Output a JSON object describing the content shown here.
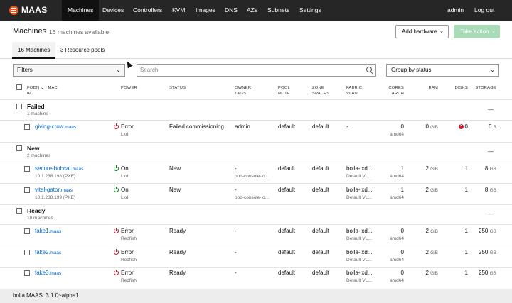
{
  "nav": {
    "brand": "MAAS",
    "items": [
      "Machines",
      "Devices",
      "Controllers",
      "KVM",
      "Images",
      "DNS",
      "AZs",
      "Subnets",
      "Settings"
    ],
    "user": "admin",
    "logout": "Log out"
  },
  "header": {
    "title": "Machines",
    "subtitle": "16 machines available",
    "add_hardware": "Add hardware",
    "take_action": "Take action"
  },
  "tabs": [
    "16 Machines",
    "3 Resource pools"
  ],
  "filters": {
    "filter_label": "Filters",
    "search_placeholder": "Search",
    "group_by": "Group by status"
  },
  "columns": {
    "fqdn": "FQDN",
    "mac": "| MAC",
    "ip": "IP",
    "power": "POWER",
    "status": "STATUS",
    "owner": "OWNER",
    "tags": "TAGS",
    "pool": "POOL",
    "note": "NOTE",
    "zone": "ZONE",
    "spaces": "SPACES",
    "fabric": "FABRIC",
    "vlan": "VLAN",
    "cores": "CORES",
    "arch": "ARCH",
    "ram": "RAM",
    "disks": "DISKS",
    "storage": "STORAGE"
  },
  "groups": [
    {
      "name": "Failed",
      "count": "1 machine",
      "collapse": "—",
      "machines": [
        {
          "host": "giving-crow",
          "domain": ".maas",
          "ip": "",
          "power": "Error",
          "power_type": "Lxd",
          "power_state": "off",
          "status": "Failed commissioning",
          "owner": "admin",
          "tags": "",
          "pool": "default",
          "zone": "default",
          "fabric": "-",
          "vlan": "",
          "cores": "0",
          "arch": "amd64",
          "ram": "0",
          "ram_unit": "GiB",
          "disks": "0",
          "disk_error": true,
          "storage": "0",
          "storage_unit": "B"
        }
      ]
    },
    {
      "name": "New",
      "count": "2 machines",
      "collapse": "—",
      "machines": [
        {
          "host": "secure-bobcat",
          "domain": ".maas",
          "ip": "10.1.238.198 (PXE)",
          "power": "On",
          "power_type": "Lxd",
          "power_state": "on",
          "status": "New",
          "owner": "-",
          "tags": "pod-console-lo...",
          "pool": "default",
          "zone": "default",
          "fabric": "bolla-lxd...",
          "vlan": "Default VL...",
          "cores": "1",
          "arch": "amd64",
          "ram": "2",
          "ram_unit": "GiB",
          "disks": "1",
          "disk_error": false,
          "storage": "8",
          "storage_unit": "GB"
        },
        {
          "host": "vital-gator",
          "domain": ".maas",
          "ip": "10.1.238.199 (PXE)",
          "power": "On",
          "power_type": "Lxd",
          "power_state": "on",
          "status": "New",
          "owner": "-",
          "tags": "pod-console-lo...",
          "pool": "default",
          "zone": "default",
          "fabric": "bolla-lxd...",
          "vlan": "Default VL...",
          "cores": "1",
          "arch": "amd64",
          "ram": "2",
          "ram_unit": "GiB",
          "disks": "1",
          "disk_error": false,
          "storage": "8",
          "storage_unit": "GB"
        }
      ]
    },
    {
      "name": "Ready",
      "count": "10 machines",
      "collapse": "—",
      "machines": [
        {
          "host": "fake1",
          "domain": ".maas",
          "ip": "",
          "power": "Error",
          "power_type": "Redfish",
          "power_state": "off",
          "status": "Ready",
          "owner": "-",
          "tags": "",
          "pool": "default",
          "zone": "default",
          "fabric": "bolla-lxd...",
          "vlan": "Default VL...",
          "cores": "0",
          "arch": "amd64",
          "ram": "2",
          "ram_unit": "GiB",
          "disks": "1",
          "disk_error": false,
          "storage": "250",
          "storage_unit": "GB"
        },
        {
          "host": "fake2",
          "domain": ".maas",
          "ip": "",
          "power": "Error",
          "power_type": "Redfish",
          "power_state": "off",
          "status": "Ready",
          "owner": "-",
          "tags": "",
          "pool": "default",
          "zone": "default",
          "fabric": "bolla-lxd...",
          "vlan": "Default VL...",
          "cores": "0",
          "arch": "amd64",
          "ram": "2",
          "ram_unit": "GiB",
          "disks": "1",
          "disk_error": false,
          "storage": "250",
          "storage_unit": "GB"
        },
        {
          "host": "fake3",
          "domain": ".maas",
          "ip": "",
          "power": "Error",
          "power_type": "Redfish",
          "power_state": "off",
          "status": "Ready",
          "owner": "-",
          "tags": "",
          "pool": "default",
          "zone": "default",
          "fabric": "bolla-lxd...",
          "vlan": "Default VL...",
          "cores": "0",
          "arch": "amd64",
          "ram": "2",
          "ram_unit": "GiB",
          "disks": "1",
          "disk_error": false,
          "storage": "250",
          "storage_unit": "GB"
        }
      ]
    }
  ],
  "footer": {
    "host": "bolla MAAS:",
    "version": "3.1.0~alpha1"
  },
  "colors": {
    "nav_bg": "#262626",
    "logo": "#e95420",
    "link": "#0066cc",
    "power_on": "#0e8420",
    "power_error": "#c7162b",
    "take_action_disabled": "#a9dbb7"
  }
}
